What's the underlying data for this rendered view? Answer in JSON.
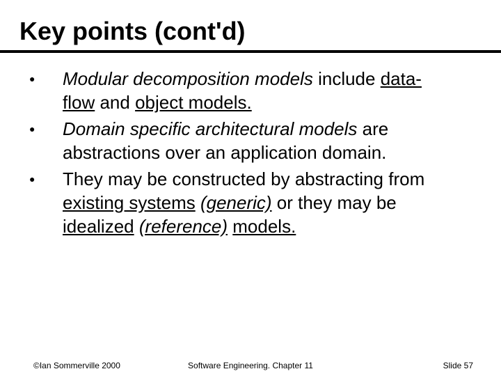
{
  "title": "Key points (cont'd)",
  "bullets": [
    {
      "segments": [
        {
          "text": "Modular decomposition models",
          "italic": true,
          "underline": false
        },
        {
          "text": " include ",
          "italic": false,
          "underline": false
        },
        {
          "text": "data-flow",
          "italic": false,
          "underline": true
        },
        {
          "text": " and ",
          "italic": false,
          "underline": false
        },
        {
          "text": "object models.",
          "italic": false,
          "underline": true
        }
      ]
    },
    {
      "segments": [
        {
          "text": "Domain specific architectural models",
          "italic": true,
          "underline": false
        },
        {
          "text": " are abstractions over an application domain.",
          "italic": false,
          "underline": false
        }
      ]
    },
    {
      "segments": [
        {
          "text": "They may be constructed by abstracting from ",
          "italic": false,
          "underline": false
        },
        {
          "text": "existing systems",
          "italic": false,
          "underline": true
        },
        {
          "text": " ",
          "italic": false,
          "underline": false
        },
        {
          "text": "(generic)",
          "italic": true,
          "underline": true
        },
        {
          "text": " or they may be ",
          "italic": false,
          "underline": false
        },
        {
          "text": "idealized",
          "italic": false,
          "underline": true
        },
        {
          "text": " ",
          "italic": false,
          "underline": false
        },
        {
          "text": "(reference)",
          "italic": true,
          "underline": true
        },
        {
          "text": " ",
          "italic": false,
          "underline": false
        },
        {
          "text": "models.",
          "italic": false,
          "underline": true
        }
      ]
    }
  ],
  "footer": {
    "left": "©Ian Sommerville 2000",
    "center": "Software Engineering. Chapter 11",
    "right": "Slide 57"
  }
}
